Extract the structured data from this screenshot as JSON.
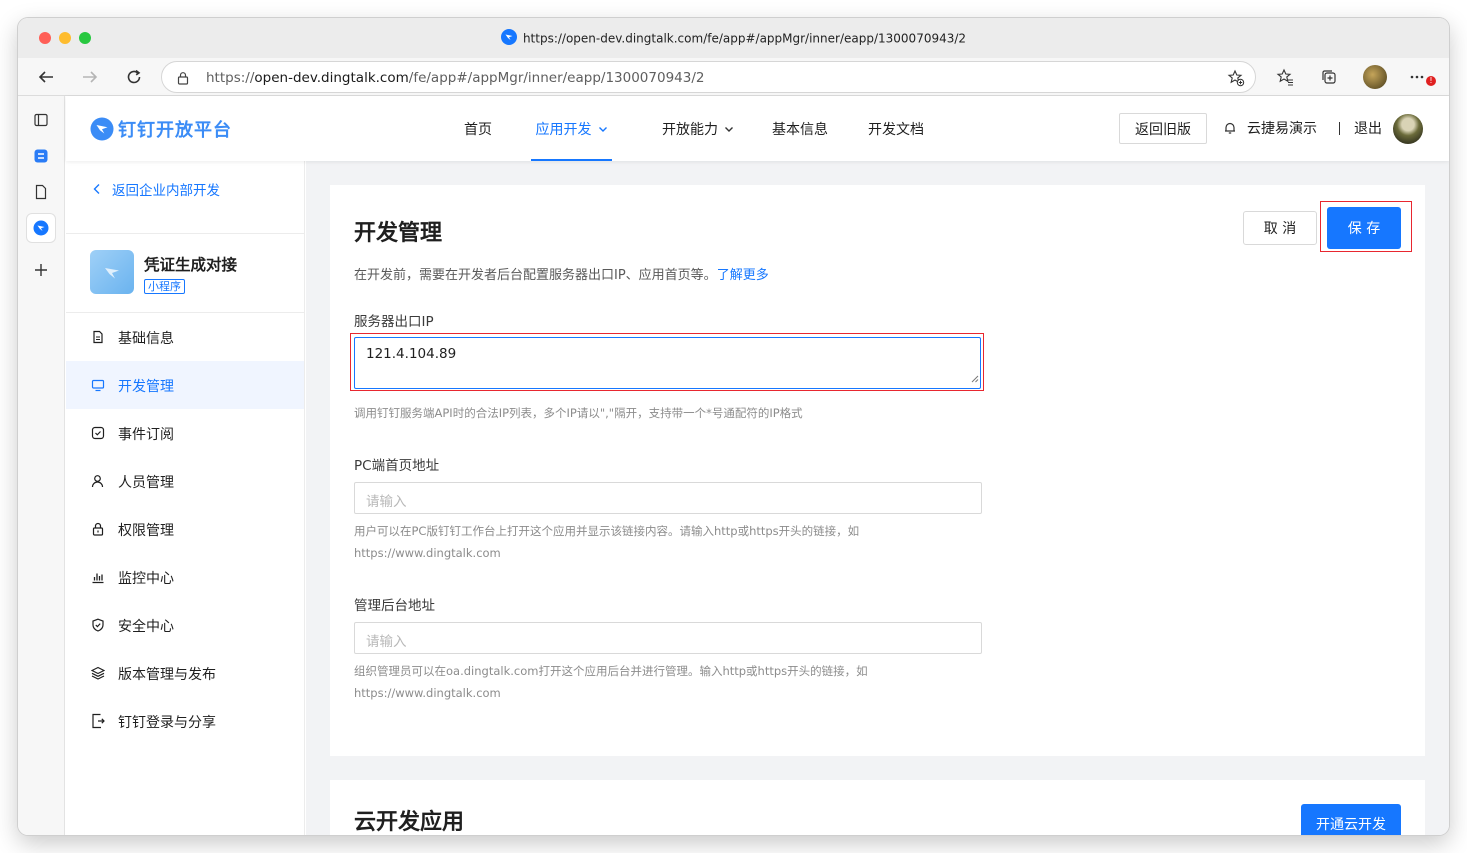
{
  "browser": {
    "tab_title": "https://open-dev.dingtalk.com/fe/app#/appMgr/inner/eapp/1300070943/2",
    "url_scheme": "https://",
    "url_host": "open-dev.dingtalk.com",
    "url_path": "/fe/app#/appMgr/inner/eapp/1300070943/2",
    "notification_badge": "!"
  },
  "header": {
    "brand": "钉钉开放平台",
    "nav": [
      {
        "label": "首页"
      },
      {
        "label": "应用开发"
      },
      {
        "label": "开放能力"
      },
      {
        "label": "基本信息"
      },
      {
        "label": "开发文档"
      }
    ],
    "old_version_label": "返回旧版",
    "org_name": "云捷易演示",
    "logout_label": "退出"
  },
  "sidebar": {
    "back_label": "返回企业内部开发",
    "app_name": "凭证生成对接",
    "app_type": "小程序",
    "items": [
      {
        "label": "基础信息",
        "icon": "document-icon"
      },
      {
        "label": "开发管理",
        "icon": "monitor-icon"
      },
      {
        "label": "事件订阅",
        "icon": "subscribe-icon"
      },
      {
        "label": "人员管理",
        "icon": "user-icon"
      },
      {
        "label": "权限管理",
        "icon": "lock-icon"
      },
      {
        "label": "监控中心",
        "icon": "bar-chart-icon"
      },
      {
        "label": "安全中心",
        "icon": "shield-icon"
      },
      {
        "label": "版本管理与发布",
        "icon": "layers-icon"
      },
      {
        "label": "钉钉登录与分享",
        "icon": "share-icon"
      }
    ]
  },
  "main": {
    "title": "开发管理",
    "desc": "在开发前，需要在开发者后台配置服务器出口IP、应用首页等。",
    "learn_more": "了解更多",
    "cancel_label": "取 消",
    "save_label": "保 存",
    "fields": {
      "ip_label": "服务器出口IP",
      "ip_value": "121.4.104.89",
      "ip_help": "调用钉钉服务端API时的合法IP列表，多个IP请以\",\"隔开，支持带一个*号通配符的IP格式",
      "pc_label": "PC端首页地址",
      "pc_placeholder": "请输入",
      "pc_help_1": "用户可以在PC版钉钉工作台上打开这个应用并显示该链接内容。请输入http或https开头的链接，如",
      "pc_help_2": "https://www.dingtalk.com",
      "admin_label": "管理后台地址",
      "admin_placeholder": "请输入",
      "admin_help_1": "组织管理员可以在oa.dingtalk.com打开这个应用后台并进行管理。输入http或https开头的链接，如",
      "admin_help_2": "https://www.dingtalk.com"
    },
    "cloud_title": "云开发应用",
    "cloud_button": "开通云开发"
  },
  "colors": {
    "accent": "#1677ff",
    "highlight": "#e8272f"
  }
}
